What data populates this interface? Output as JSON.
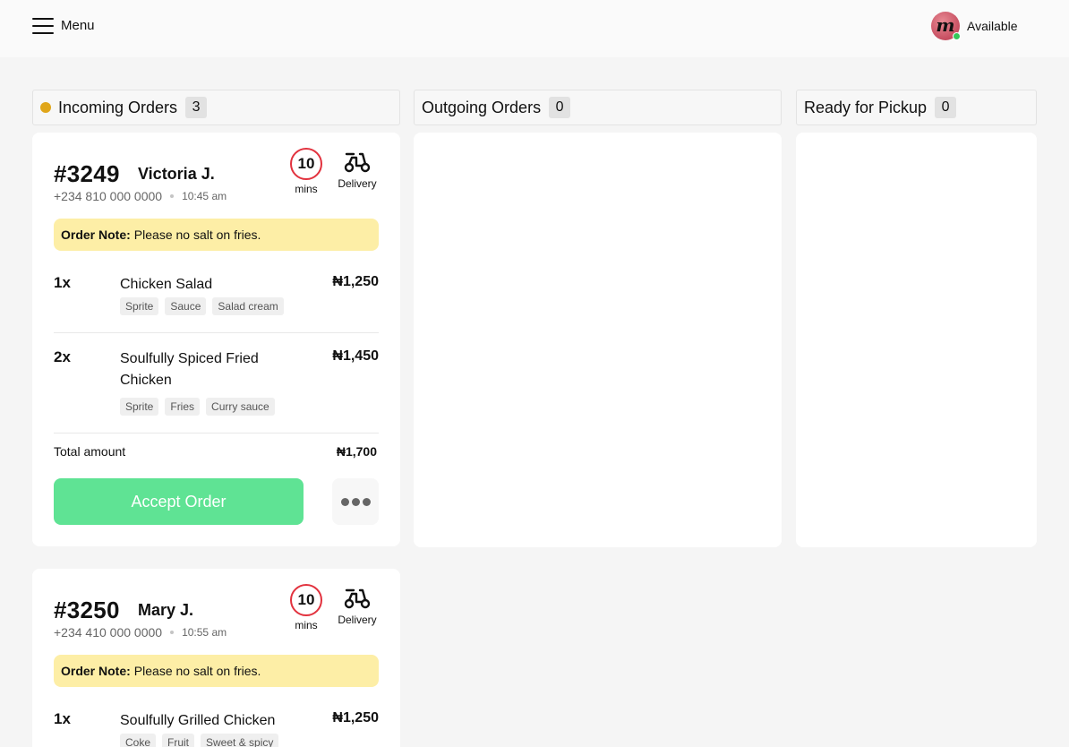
{
  "topbar": {
    "menu_label": "Menu",
    "status_label": "Available",
    "avatar_letter": "m"
  },
  "columns": [
    {
      "title": "Incoming Orders",
      "count": "3"
    },
    {
      "title": "Outgoing Orders",
      "count": "0"
    },
    {
      "title": "Ready for Pickup",
      "count": "0"
    }
  ],
  "colors": {
    "accent_green": "#5fe394",
    "timer_red": "#e2323e",
    "note_yellow": "#fdeea6",
    "incoming_dot": "#e0a61a"
  },
  "orders": [
    {
      "id": "#3249",
      "customer": "Victoria J.",
      "phone": "+234 810 000 0000",
      "time": "10:45 am",
      "timer_value": "10",
      "timer_unit": "mins",
      "mode": "Delivery",
      "note_label": "Order Note:",
      "note_text": "Please no salt on fries.",
      "items": [
        {
          "qty": "1x",
          "name": "Chicken Salad",
          "price": "₦1,250",
          "extras": [
            "Sprite",
            "Sauce",
            "Salad cream"
          ]
        },
        {
          "qty": "2x",
          "name": "Soulfully Spiced Fried Chicken",
          "price": "₦1,450",
          "extras": [
            "Sprite",
            "Fries",
            "Curry sauce"
          ]
        }
      ],
      "total_label": "Total amount",
      "total_value": "₦1,700",
      "accept_label": "Accept Order",
      "more_icon": "more-horizontal-icon"
    },
    {
      "id": "#3250",
      "customer": "Mary J.",
      "phone": "+234 410 000 0000",
      "time": "10:55 am",
      "timer_value": "10",
      "timer_unit": "mins",
      "mode": "Delivery",
      "note_label": "Order Note:",
      "note_text": "Please no salt on fries.",
      "items": [
        {
          "qty": "1x",
          "name": "Soulfully Grilled Chicken",
          "price": "₦1,250",
          "extras": [
            "Coke",
            "Fruit",
            "Sweet & spicy"
          ]
        }
      ]
    }
  ]
}
